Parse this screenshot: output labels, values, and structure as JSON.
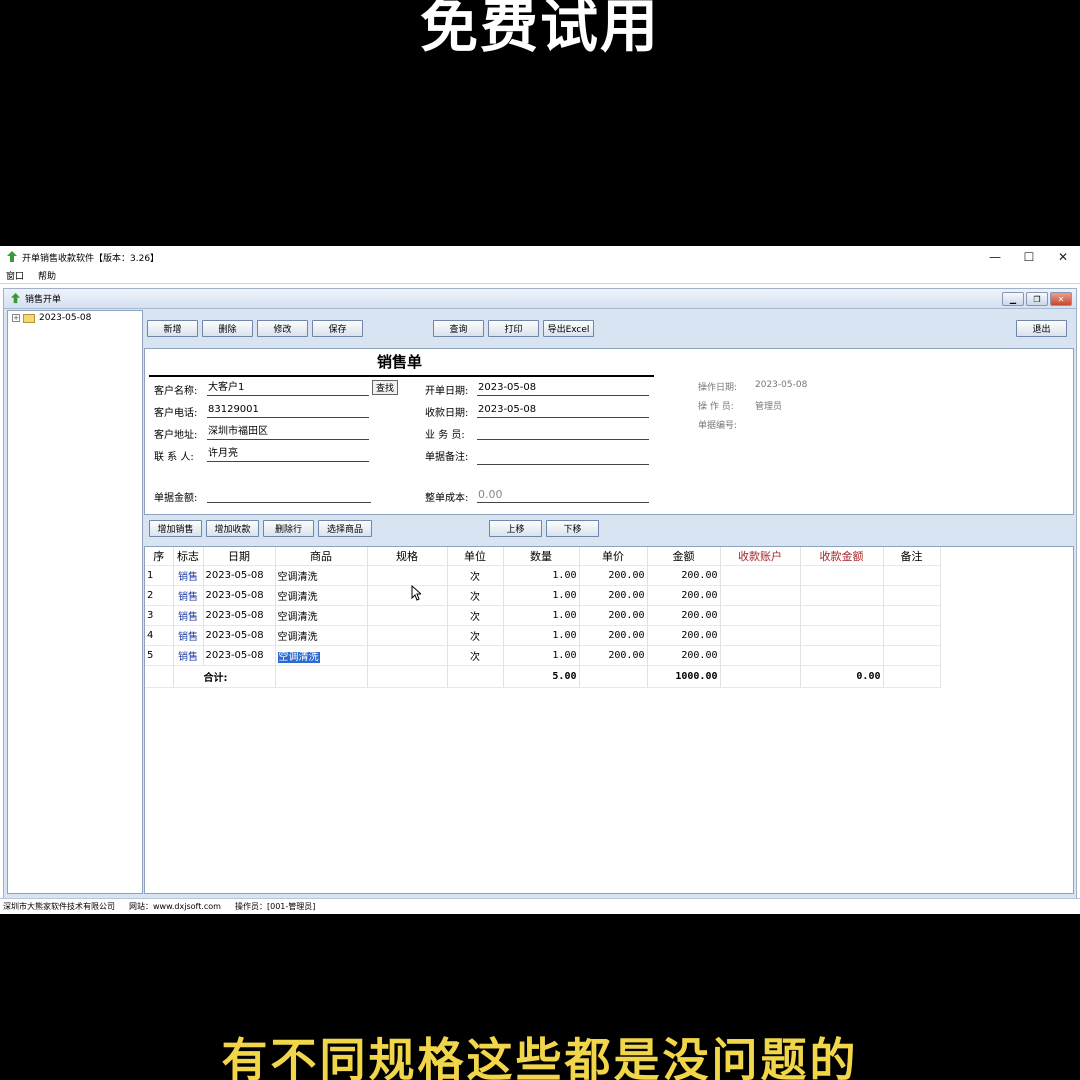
{
  "overlay": {
    "top_text": "免费试用",
    "bottom_text": "有不同规格这些都是没问题的"
  },
  "window": {
    "title": "开单销售收款软件【版本：3.26】",
    "menu": [
      "窗口",
      "帮助"
    ],
    "controls": {
      "minimize": "—",
      "maximize": "☐",
      "close": "✕"
    }
  },
  "child_window": {
    "title": "销售开单"
  },
  "tree": {
    "items": [
      {
        "label": "2023-05-08"
      }
    ]
  },
  "toolbar": {
    "new": "新增",
    "delete": "删除",
    "edit": "修改",
    "save": "保存",
    "query": "查询",
    "print": "打印",
    "export": "导出Excel",
    "exit": "退出"
  },
  "form": {
    "title": "销售单",
    "customer_name_label": "客户名称:",
    "customer_name": "大客户1",
    "find_button": "查找",
    "customer_phone_label": "客户电话:",
    "customer_phone": "83129001",
    "customer_address_label": "客户地址:",
    "customer_address": "深圳市福田区",
    "contact_label": "联 系 人:",
    "contact": "许月亮",
    "open_date_label": "开单日期:",
    "open_date": "2023-05-08",
    "collect_date_label": "收款日期:",
    "collect_date": "2023-05-08",
    "salesman_label": "业 务 员:",
    "salesman": "",
    "remark_label": "单据备注:",
    "remark": "",
    "amount_label": "单据金额:",
    "amount": "",
    "cost_label": "整单成本:",
    "cost": "0.00",
    "op_date_label": "操作日期:",
    "op_date": "2023-05-08",
    "operator_label": "操 作 员:",
    "operator": "管理员",
    "doc_no_label": "单据编号:"
  },
  "toolbar2": {
    "add_sale": "增加销售",
    "add_collection": "增加收款",
    "delete_row": "删除行",
    "select_product": "选择商品",
    "move_up": "上移",
    "move_down": "下移"
  },
  "grid": {
    "headers": [
      "序",
      "标志",
      "日期",
      "商品",
      "规格",
      "单位",
      "数量",
      "单价",
      "金额",
      "收款账户",
      "收款金额",
      "备注"
    ],
    "rows": [
      {
        "seq": "1",
        "flag": "销售",
        "date": "2023-05-08",
        "product": "空调清洗",
        "spec": "",
        "unit": "次",
        "qty": "1.00",
        "price": "200.00",
        "amount": "200.00",
        "account": "",
        "collected": "",
        "note": ""
      },
      {
        "seq": "2",
        "flag": "销售",
        "date": "2023-05-08",
        "product": "空调清洗",
        "spec": "",
        "unit": "次",
        "qty": "1.00",
        "price": "200.00",
        "amount": "200.00",
        "account": "",
        "collected": "",
        "note": ""
      },
      {
        "seq": "3",
        "flag": "销售",
        "date": "2023-05-08",
        "product": "空调清洗",
        "spec": "",
        "unit": "次",
        "qty": "1.00",
        "price": "200.00",
        "amount": "200.00",
        "account": "",
        "collected": "",
        "note": ""
      },
      {
        "seq": "4",
        "flag": "销售",
        "date": "2023-05-08",
        "product": "空调清洗",
        "spec": "",
        "unit": "次",
        "qty": "1.00",
        "price": "200.00",
        "amount": "200.00",
        "account": "",
        "collected": "",
        "note": ""
      },
      {
        "seq": "5",
        "flag": "销售",
        "date": "2023-05-08",
        "product": "空调清洗",
        "spec": "",
        "unit": "次",
        "qty": "1.00",
        "price": "200.00",
        "amount": "200.00",
        "account": "",
        "collected": "",
        "note": ""
      }
    ],
    "total": {
      "label": "合计:",
      "qty": "5.00",
      "amount": "1000.00",
      "collected": "0.00"
    }
  },
  "statusbar": {
    "company": "深圳市大熊家软件技术有限公司",
    "website": "网站：www.dxjsoft.com",
    "operator": "操作员：[001-管理员]"
  },
  "colors": {
    "accent_red": "#a3262a",
    "flag_blue": "#1c3aa0",
    "selection": "#2d6bd1"
  }
}
